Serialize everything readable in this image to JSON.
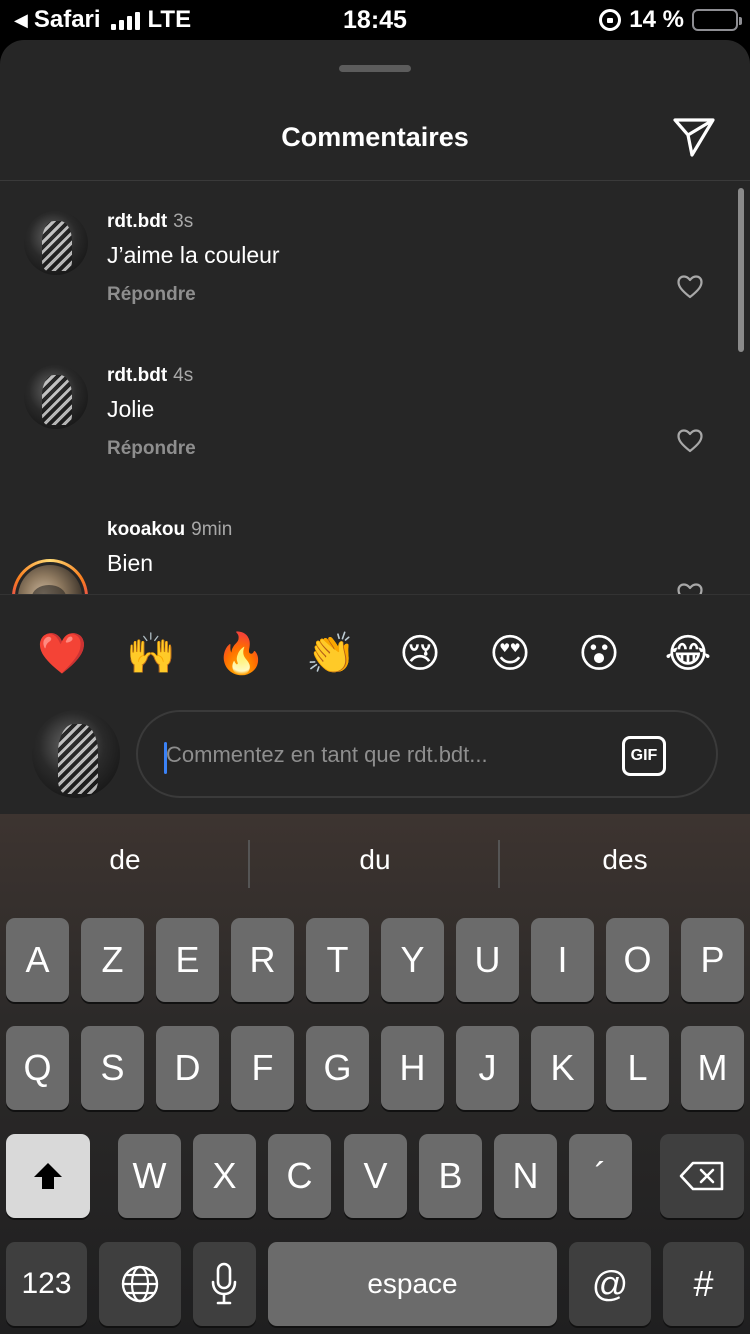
{
  "status_bar": {
    "back_app": "Safari",
    "carrier": "LTE",
    "time": "18:45",
    "battery_text": "14 %",
    "battery_level": 0.14
  },
  "sheet": {
    "title": "Commentaires"
  },
  "comments": [
    {
      "user": "rdt.bdt",
      "time": "3s",
      "text": "J’aime la couleur",
      "reply": "Répondre"
    },
    {
      "user": "rdt.bdt",
      "time": "4s",
      "text": "Jolie",
      "reply": "Répondre"
    },
    {
      "user": "kooakou",
      "time": "9min",
      "text": "Bien"
    }
  ],
  "emojis": [
    "❤️",
    "🙌",
    "🔥",
    "👏",
    "😢",
    "😍",
    "😮",
    "😂"
  ],
  "composer": {
    "placeholder": "Commentez en tant que rdt.bdt...",
    "gif_label": "GIF"
  },
  "keyboard": {
    "suggestions": [
      "de",
      "du",
      "des"
    ],
    "row1": [
      "A",
      "Z",
      "E",
      "R",
      "T",
      "Y",
      "U",
      "I",
      "O",
      "P"
    ],
    "row2": [
      "Q",
      "S",
      "D",
      "F",
      "G",
      "H",
      "J",
      "K",
      "L",
      "M"
    ],
    "row3": [
      "W",
      "X",
      "C",
      "V",
      "B",
      "N",
      "´"
    ],
    "numbers_label": "123",
    "space_label": "espace",
    "at_label": "@",
    "hash_label": "#"
  },
  "icons": {
    "back": "back-arrow-icon",
    "send": "paper-plane-icon",
    "like": "heart-icon",
    "shift": "shift-arrow-icon",
    "backspace": "backspace-icon",
    "globe": "globe-icon",
    "mic": "microphone-icon"
  },
  "colors": {
    "sheet_bg": "#262626",
    "cursor": "#3b82f6",
    "battery": "#ffcc00"
  }
}
